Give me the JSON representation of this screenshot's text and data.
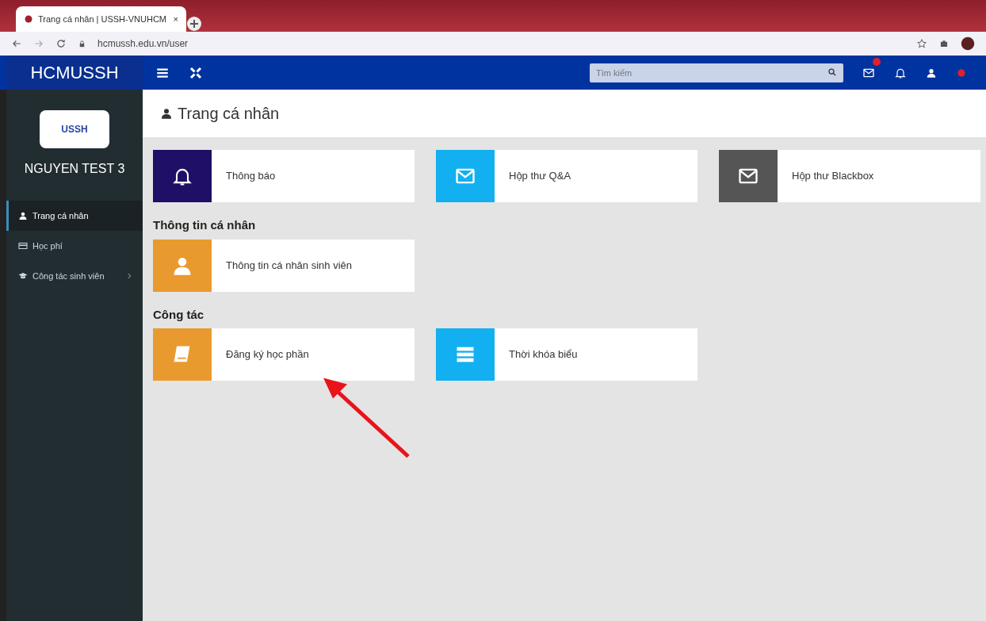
{
  "browser": {
    "tab_title": "Trang cá nhân | USSH-VNUHCM",
    "tab_close": "×",
    "url": "hcmussh.edu.vn/user"
  },
  "navbar": {
    "brand": "HCMUSSH",
    "search_placeholder": "Tìm kiếm"
  },
  "sidebar": {
    "logo_text": "USSH",
    "user_name": "NGUYEN TEST 3",
    "items": [
      {
        "label": "Trang cá nhân",
        "kind": "user",
        "selected": true,
        "has_submenu": false
      },
      {
        "label": "Học phí",
        "kind": "card",
        "selected": false,
        "has_submenu": false
      },
      {
        "label": "Công tác sinh viên",
        "kind": "cap",
        "selected": false,
        "has_submenu": true
      }
    ]
  },
  "page_title": "Trang cá nhân",
  "sections": [
    {
      "tiles": [
        {
          "label": "Thông báo",
          "kind": "bell",
          "color": "#1f0f66"
        },
        {
          "label": "Hộp thư Q&A",
          "kind": "mail",
          "color": "#12b0f0"
        },
        {
          "label": "Hộp thư Blackbox",
          "kind": "mail",
          "color": "#555555"
        }
      ]
    },
    {
      "heading": "Thông tin cá nhân",
      "tiles": [
        {
          "label": "Thông tin cá nhân sinh viên",
          "kind": "user",
          "color": "#e99a2e"
        }
      ]
    },
    {
      "heading": "Công tác",
      "tiles": [
        {
          "label": "Đăng ký học phần",
          "kind": "book",
          "color": "#e99a2e"
        },
        {
          "label": "Thời khóa biểu",
          "kind": "list",
          "color": "#12b0f0"
        }
      ]
    }
  ]
}
